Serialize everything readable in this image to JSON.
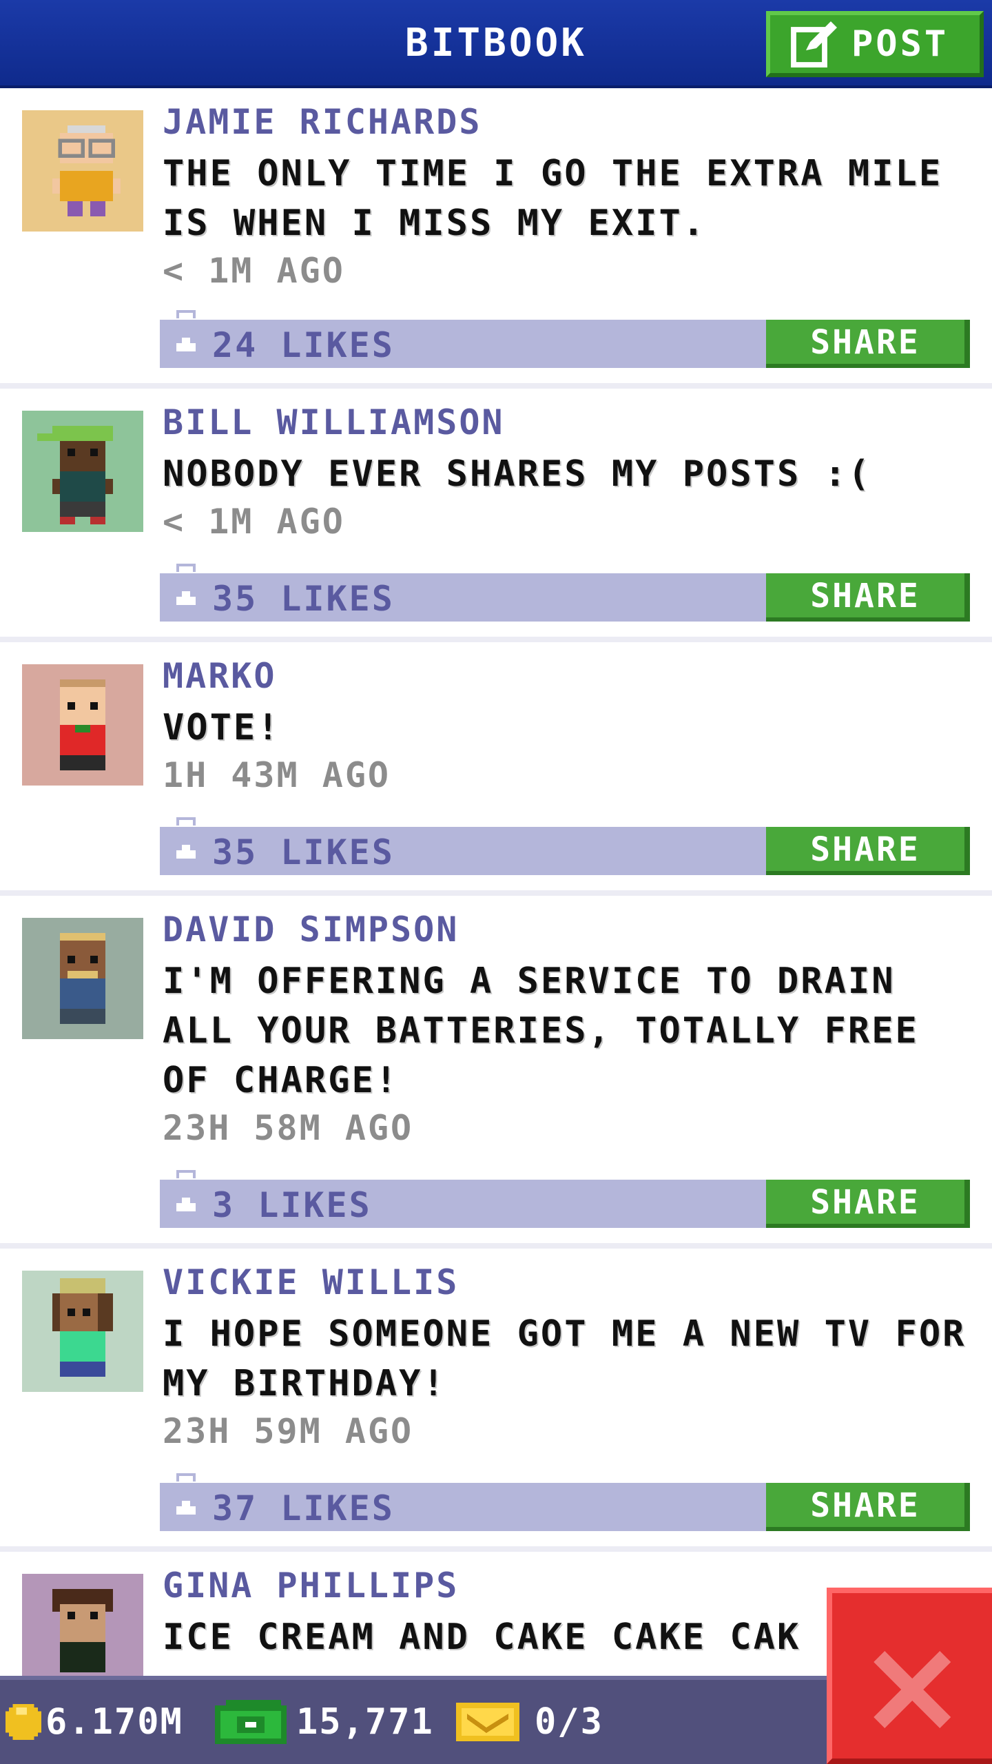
{
  "header": {
    "title": "BITBOOK",
    "post_label": "POST"
  },
  "posts": [
    {
      "author": "JAMIE RICHARDS",
      "message": "THE ONLY TIME I GO THE EXTRA MILE IS WHEN I MISS MY EXIT.",
      "time": "< 1M AGO",
      "likes": "24 LIKES",
      "share": "SHARE",
      "avatar_bg": "#eac888"
    },
    {
      "author": "BILL WILLIAMSON",
      "message": "NOBODY EVER SHARES MY POSTS :(",
      "time": "< 1M AGO",
      "likes": "35 LIKES",
      "share": "SHARE",
      "avatar_bg": "#8ec49a"
    },
    {
      "author": "MARKO",
      "message": "VOTE!",
      "time": "1H 43M AGO",
      "likes": "35 LIKES",
      "share": "SHARE",
      "avatar_bg": "#d7a89e"
    },
    {
      "author": "DAVID SIMPSON",
      "message": "I'M OFFERING A SERVICE TO DRAIN ALL YOUR BATTERIES, TOTALLY FREE OF CHARGE!",
      "time": "23H 58M AGO",
      "likes": "3 LIKES",
      "share": "SHARE",
      "avatar_bg": "#98aca0"
    },
    {
      "author": "VICKIE WILLIS",
      "message": "I HOPE SOMEONE GOT ME A NEW TV FOR MY BIRTHDAY!",
      "time": "23H 59M AGO",
      "likes": "37 LIKES",
      "share": "SHARE",
      "avatar_bg": "#bed6c4"
    },
    {
      "author": "GINA PHILLIPS",
      "message": "ICE CREAM AND CAKE CAKE CAK",
      "avatar_bg": "#b496b8"
    }
  ],
  "footer": {
    "coins": "6.170M",
    "bux": "15,771",
    "tickets": "0/3"
  },
  "colors": {
    "header": "#1b3aa8",
    "share_green": "#49a83a",
    "likes_bar": "#b4b6da",
    "footer": "#51507c",
    "close_red": "#e52e2e"
  }
}
